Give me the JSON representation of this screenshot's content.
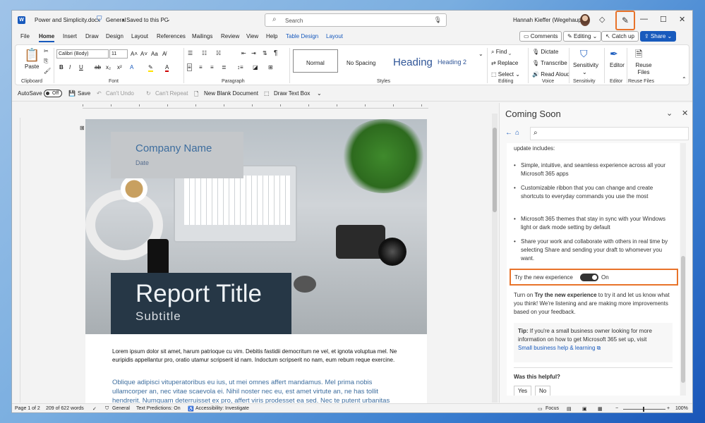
{
  "title_bar": {
    "doc_title": "Power and Simplicity.docx",
    "sensitivity": "General",
    "separator": "•",
    "saved_status": "Saved to this PC",
    "search_placeholder": "Search",
    "user_name": "Hannah Kieffer (Wegehaupt)"
  },
  "tabs": [
    "File",
    "Home",
    "Insert",
    "Draw",
    "Design",
    "Layout",
    "References",
    "Mailings",
    "Review",
    "View",
    "Help",
    "Table Design",
    "Layout"
  ],
  "ribbon_right_buttons": {
    "comments": "Comments",
    "editing": "Editing",
    "catch_up": "Catch up",
    "share": "Share"
  },
  "ribbon": {
    "clipboard": {
      "label": "Clipboard",
      "paste": "Paste"
    },
    "font": {
      "label": "Font",
      "name": "Calibri (Body)",
      "size": "11"
    },
    "paragraph": {
      "label": "Paragraph"
    },
    "styles": {
      "label": "Styles",
      "items": [
        "Normal",
        "No Spacing",
        "Heading",
        "Heading 2"
      ]
    },
    "editing": {
      "label": "Editing",
      "find": "Find",
      "replace": "Replace",
      "select": "Select"
    },
    "voice": {
      "label": "Voice",
      "dictate": "Dictate",
      "transcribe": "Transcribe",
      "read_aloud": "Read Aloud"
    },
    "sensitivity": {
      "label": "Sensitivity",
      "button": "Sensitivity"
    },
    "editor": {
      "label": "Editor",
      "button": "Editor"
    },
    "reuse": {
      "label": "Reuse Files",
      "button": "Reuse Files"
    }
  },
  "quick_access": {
    "autosave": "AutoSave",
    "autosave_state": "Off",
    "save": "Save",
    "undo": "Can't Undo",
    "repeat": "Can't Repeat",
    "new_blank": "New Blank Document",
    "draw_text_box": "Draw Text Box"
  },
  "document": {
    "company_name": "Company Name",
    "date": "Date",
    "report_title": "Report Title",
    "subtitle": "Subtitle",
    "para1": "Lorem ipsum dolor sit amet, harum patrioque cu vim. Debitis fastidii democritum ne vel, et ignota voluptua mel. Ne euripidis appellantur pro, oratio utamur scripserit id nam. Indoctum scripserit no nam, eum rebum reque exercine.",
    "para2": "Oblique adipisci vituperatoribus eu ius, ut mei omnes affert mandamus. Mel prima nobis ullamcorper an, nec vitae scaevola ei. Nihil noster nec eu, est amet virtute an, ne has tollit hendrerit. Numquam deterruisset ex pro, affert viris prodesset ea sed. Nec te putent urbanitas"
  },
  "pane": {
    "title": "Coming Soon",
    "intro": "update includes:",
    "bullets": [
      "Simple, intuitive, and seamless experience across all your Microsoft 365 apps",
      "Customizable ribbon that you can change and create shortcuts to everyday commands you use the most",
      "Microsoft 365 themes that stay in sync with your Windows light or dark mode setting by default",
      "Share your work and collaborate with others in real time by selecting Share and sending your draft to whomever you want."
    ],
    "try_label": "Try the new experience",
    "try_state": "On",
    "turn_on_pre": "Turn on ",
    "turn_on_bold": "Try the new experience",
    "turn_on_post": " to try it and let us know what you think! We're listening and are making more improvements based on your feedback.",
    "tip_label": "Tip:",
    "tip_text": " If you're a small business owner looking for more information on how to get Microsoft 365 set up, visit",
    "tip_link": "Small business help & learning",
    "helpful_q": "Was this helpful?",
    "yes": "Yes",
    "no": "No"
  },
  "status_bar": {
    "page": "Page 1 of 2",
    "words": "209 of 622 words",
    "sensitivity": "General",
    "text_predictions": "Text Predictions: On",
    "accessibility": "Accessibility: Investigate",
    "focus": "Focus",
    "zoom": "100%"
  }
}
